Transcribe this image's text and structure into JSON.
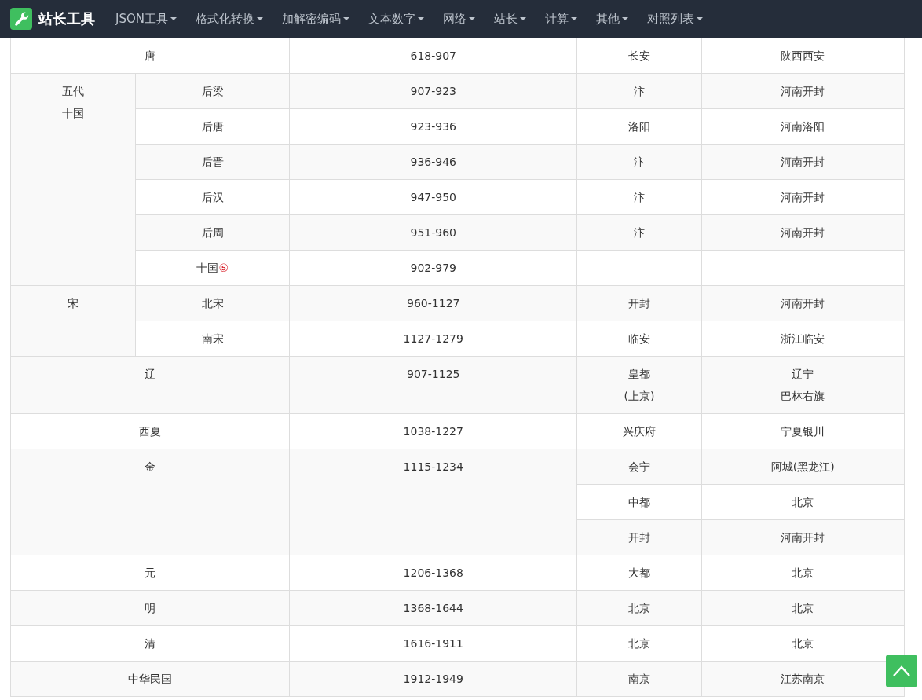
{
  "navbar": {
    "brand": "站长工具",
    "items": [
      {
        "label": "JSON工具"
      },
      {
        "label": "格式化转换"
      },
      {
        "label": "加解密编码"
      },
      {
        "label": "文本数字"
      },
      {
        "label": "网络"
      },
      {
        "label": "站长"
      },
      {
        "label": "计算"
      },
      {
        "label": "其他"
      },
      {
        "label": "对照列表"
      }
    ]
  },
  "dynasties": [
    {
      "name": [
        "唐"
      ],
      "years": "618-907",
      "seats": [
        {
          "capital": [
            "长安"
          ],
          "location": [
            "陕西西安"
          ]
        }
      ]
    },
    {
      "name": [
        "五代",
        "十国"
      ],
      "subdivisions": [
        {
          "name": "后梁",
          "years": "907-923",
          "capital": "汴",
          "location": "河南开封"
        },
        {
          "name": "后唐",
          "years": "923-936",
          "capital": "洛阳",
          "location": "河南洛阳"
        },
        {
          "name": "后晋",
          "years": "936-946",
          "capital": "汴",
          "location": "河南开封"
        },
        {
          "name": "后汉",
          "years": "947-950",
          "capital": "汴",
          "location": "河南开封"
        },
        {
          "name": "后周",
          "years": "951-960",
          "capital": "汴",
          "location": "河南开封"
        },
        {
          "name": "十国",
          "note": "⑤",
          "years": "902-979",
          "capital": "—",
          "location": "—"
        }
      ]
    },
    {
      "name": [
        "宋"
      ],
      "subdivisions": [
        {
          "name": "北宋",
          "years": "960-1127",
          "capital": "开封",
          "location": "河南开封"
        },
        {
          "name": "南宋",
          "years": "1127-1279",
          "capital": "临安",
          "location": "浙江临安"
        }
      ]
    },
    {
      "name": [
        "辽"
      ],
      "years": "907-1125",
      "seats": [
        {
          "capital": [
            "皇都",
            "(上京)"
          ],
          "location": [
            "辽宁",
            "巴林右旗"
          ]
        }
      ]
    },
    {
      "name": [
        "西夏"
      ],
      "years": "1038-1227",
      "seats": [
        {
          "capital": [
            "兴庆府"
          ],
          "location": [
            "宁夏银川"
          ]
        }
      ]
    },
    {
      "name": [
        "金"
      ],
      "years": "1115-1234",
      "seats": [
        {
          "capital": [
            "会宁"
          ],
          "location": [
            "阿城(黑龙江)"
          ]
        },
        {
          "capital": [
            "中都"
          ],
          "location": [
            "北京"
          ]
        },
        {
          "capital": [
            "开封"
          ],
          "location": [
            "河南开封"
          ]
        }
      ]
    },
    {
      "name": [
        "元"
      ],
      "years": "1206-1368",
      "seats": [
        {
          "capital": [
            "大都"
          ],
          "location": [
            "北京"
          ]
        }
      ]
    },
    {
      "name": [
        "明"
      ],
      "years": "1368-1644",
      "seats": [
        {
          "capital": [
            "北京"
          ],
          "location": [
            "北京"
          ]
        }
      ]
    },
    {
      "name": [
        "清"
      ],
      "years": "1616-1911",
      "seats": [
        {
          "capital": [
            "北京"
          ],
          "location": [
            "北京"
          ]
        }
      ]
    },
    {
      "name": [
        "中华民国"
      ],
      "years": "1912-1949",
      "seats": [
        {
          "capital": [
            "南京"
          ],
          "location": [
            "江苏南京"
          ]
        }
      ]
    }
  ]
}
